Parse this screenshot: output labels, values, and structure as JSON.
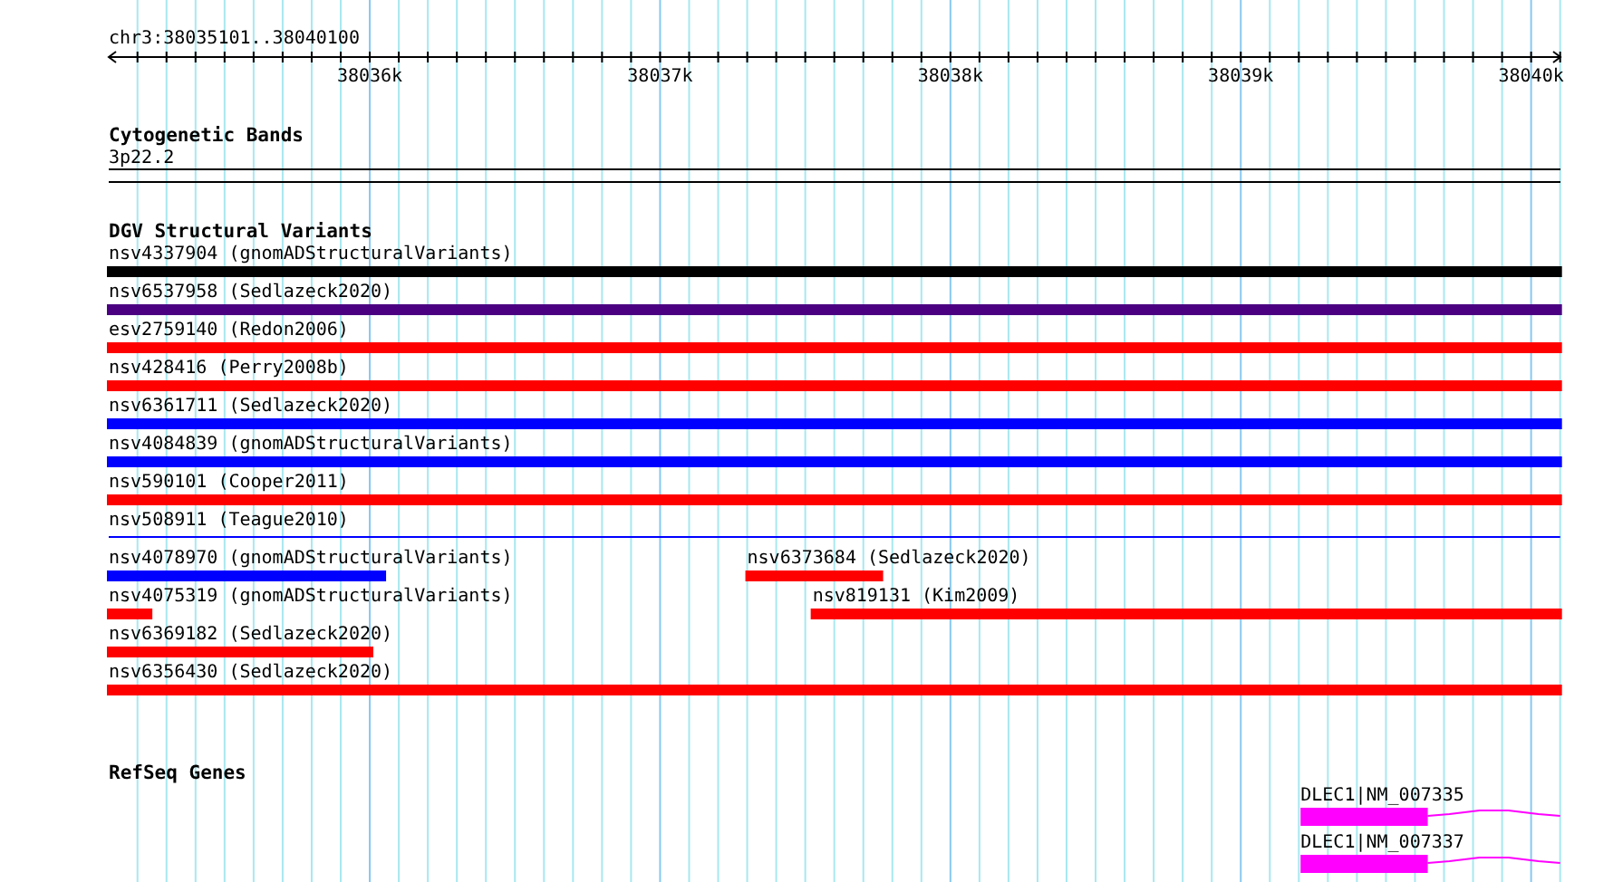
{
  "ruler": {
    "location": "chr3:38035101..38040100",
    "ticks": [
      {
        "label": "38036k"
      },
      {
        "label": "38037k"
      },
      {
        "label": "38038k"
      },
      {
        "label": "38039k"
      },
      {
        "label": "38040k"
      }
    ]
  },
  "cytobands": {
    "title": "Cytogenetic Bands",
    "band": "3p22.2"
  },
  "dgv": {
    "title": "DGV Structural Variants",
    "lanes": [
      [
        {
          "label": "nsv4337904 (gnomADStructuralVariants)",
          "kind": "bar",
          "color": "#000000"
        }
      ],
      [
        {
          "label": "nsv6537958 (Sedlazeck2020)",
          "kind": "bar",
          "color": "#4b0082"
        }
      ],
      [
        {
          "label": "esv2759140 (Redon2006)",
          "kind": "bar",
          "color": "#ff0000"
        }
      ],
      [
        {
          "label": "nsv428416 (Perry2008b)",
          "kind": "bar",
          "color": "#ff0000"
        }
      ],
      [
        {
          "label": "nsv6361711 (Sedlazeck2020)",
          "kind": "bar",
          "color": "#0000ff"
        }
      ],
      [
        {
          "label": "nsv4084839 (gnomADStructuralVariants)",
          "kind": "bar",
          "color": "#0000ff"
        }
      ],
      [
        {
          "label": "nsv590101 (Cooper2011)",
          "kind": "bar",
          "color": "#ff0000"
        }
      ],
      [
        {
          "label": "nsv508911 (Teague2010)",
          "kind": "line",
          "color": "#0000ff"
        }
      ],
      [
        {
          "label": "nsv4078970 (gnomADStructuralVariants)",
          "kind": "bar",
          "color": "#0000ff"
        },
        {
          "label": "nsv6373684 (Sedlazeck2020)",
          "kind": "bar",
          "color": "#ff0000"
        }
      ],
      [
        {
          "label": "nsv4075319 (gnomADStructuralVariants)",
          "kind": "bar",
          "color": "#ff0000"
        },
        {
          "label": "nsv819131 (Kim2009)",
          "kind": "bar",
          "color": "#ff0000"
        }
      ],
      [
        {
          "label": "nsv6369182 (Sedlazeck2020)",
          "kind": "bar",
          "color": "#ff0000"
        }
      ],
      [
        {
          "label": "nsv6356430 (Sedlazeck2020)",
          "kind": "bar",
          "color": "#ff0000"
        }
      ]
    ]
  },
  "refseq": {
    "title": "RefSeq Genes",
    "genes": [
      {
        "label": "DLEC1|NM_007335"
      },
      {
        "label": "DLEC1|NM_007337"
      }
    ]
  }
}
